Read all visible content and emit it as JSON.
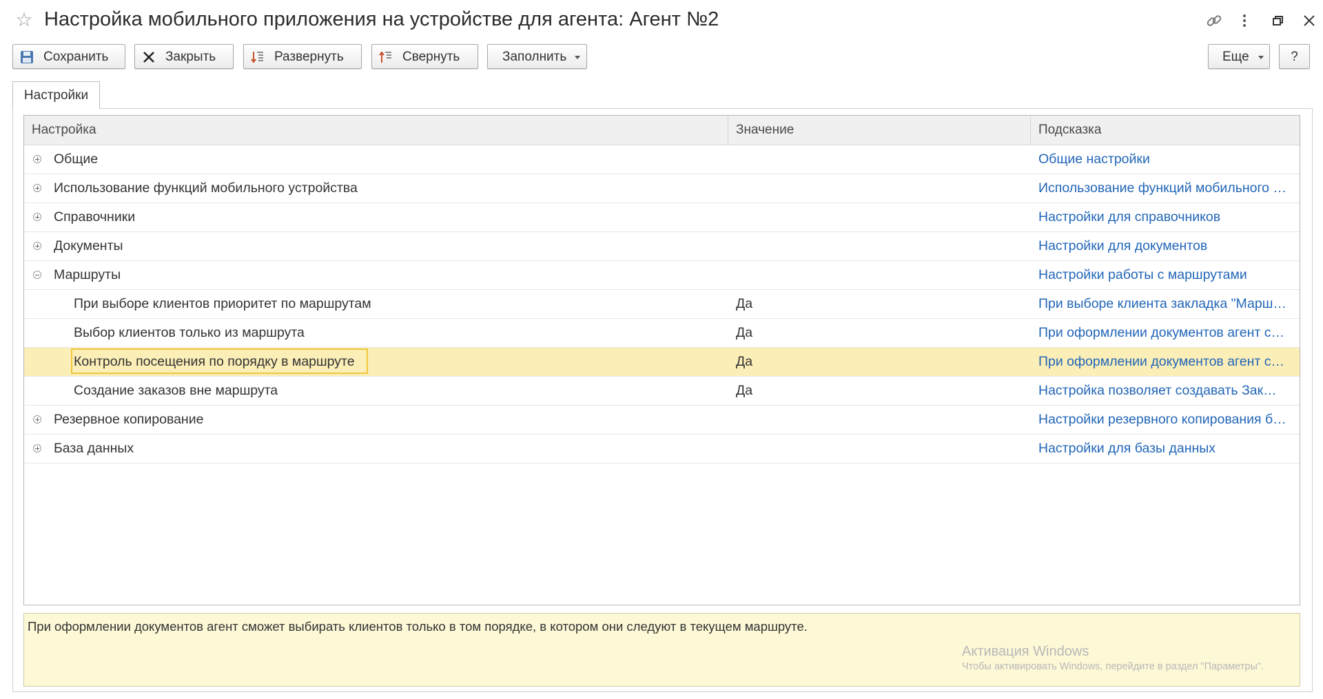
{
  "window": {
    "title": "Настройка мобильного приложения на устройстве для агента: Агент №2"
  },
  "toolbar": {
    "save_label": "Сохранить",
    "close_label": "Закрыть",
    "expand_label": "Развернуть",
    "collapse_label": "Свернуть",
    "fill_label": "Заполнить",
    "more_label": "Еще",
    "help_label": "?"
  },
  "tabs": [
    {
      "label": "Настройки",
      "active": true
    }
  ],
  "grid": {
    "columns": {
      "setting": "Настройка",
      "value": "Значение",
      "hint": "Подсказка"
    },
    "rows": [
      {
        "setting": "Общие",
        "value": "",
        "hint": "Общие настройки",
        "group": true,
        "expanded": false
      },
      {
        "setting": "Использование функций мобильного устройства",
        "value": "",
        "hint": "Использование функций мобильного …",
        "group": true,
        "expanded": false
      },
      {
        "setting": "Справочники",
        "value": "",
        "hint": "Настройки для справочников",
        "group": true,
        "expanded": false
      },
      {
        "setting": "Документы",
        "value": "",
        "hint": "Настройки для документов",
        "group": true,
        "expanded": false
      },
      {
        "setting": "Маршруты",
        "value": "",
        "hint": "Настройки работы с маршрутами",
        "group": true,
        "expanded": true
      },
      {
        "setting": "При выборе клиентов приоритет по маршрутам",
        "value": "Да",
        "hint": "При выборе клиента закладка \"Марш…",
        "group": false
      },
      {
        "setting": "Выбор клиентов только из маршрута",
        "value": "Да",
        "hint": "При оформлении документов агент с…",
        "group": false
      },
      {
        "setting": "Контроль посещения по порядку в маршруте",
        "value": "Да",
        "hint": "При оформлении документов агент с…",
        "group": false,
        "selected": true
      },
      {
        "setting": "Создание заказов вне маршрута",
        "value": "Да",
        "hint": "Настройка позволяет создавать Зак…",
        "group": false
      },
      {
        "setting": "Резервное копирование",
        "value": "",
        "hint": "Настройки резервного копирования б…",
        "group": true,
        "expanded": false
      },
      {
        "setting": "База данных",
        "value": "",
        "hint": "Настройки для базы данных",
        "group": true,
        "expanded": false
      }
    ]
  },
  "description": {
    "text": "При оформлении документов агент сможет выбирать клиентов только в том порядке, в котором они следуют в текущем маршруте."
  },
  "watermark": {
    "line1": "Активация Windows",
    "line2": "Чтобы активировать Windows, перейдите в раздел \"Параметры\"."
  },
  "colors": {
    "selected_row": "#fbeeb7",
    "focus_border": "#f0c73a",
    "hint_link": "#2266b8",
    "description_bg": "#fdf8d6"
  },
  "icons": [
    "star-icon",
    "link-icon",
    "more-vertical-icon",
    "restore-icon",
    "close-icon",
    "save-icon",
    "close-x-icon",
    "expand-icon",
    "collapse-icon"
  ]
}
